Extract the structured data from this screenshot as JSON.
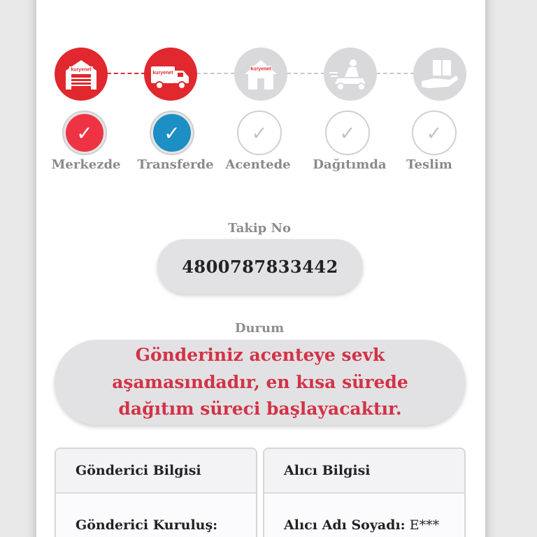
{
  "colors": {
    "accent": "#e0282e",
    "done_check": "#ee3444",
    "transfer_check": "#1d8fc4",
    "inactive": "#d9d9db",
    "status_text": "#d33246"
  },
  "tracker": {
    "steps": [
      {
        "label": "Merkezde",
        "icon": "warehouse-icon",
        "state": "done",
        "check": "red"
      },
      {
        "label": "Transferde",
        "icon": "truck-icon",
        "state": "current",
        "check": "blue"
      },
      {
        "label": "Acentede",
        "icon": "agency-house-icon",
        "state": "pending",
        "check": "none"
      },
      {
        "label": "Dağıtımda",
        "icon": "scooter-courier-icon",
        "state": "pending",
        "check": "none"
      },
      {
        "label": "Teslim",
        "icon": "package-hand-icon",
        "state": "pending",
        "check": "none"
      }
    ],
    "brand": "kuryenet",
    "check_glyph": "✓"
  },
  "tracking": {
    "label": "Takip No",
    "value": "4800787833442"
  },
  "status": {
    "label": "Durum",
    "text": "Gönderiniz acenteye sevk aşamasındadır, en kısa sürede dağıtım süreci başlayacaktır."
  },
  "sender": {
    "title": "Gönderici Bilgisi",
    "company_label": "Gönderici Kuruluş:",
    "company_value": ""
  },
  "receiver": {
    "title": "Alıcı Bilgisi",
    "name_label": "Alıcı Adı Soyadı:",
    "name_value": "E***"
  }
}
